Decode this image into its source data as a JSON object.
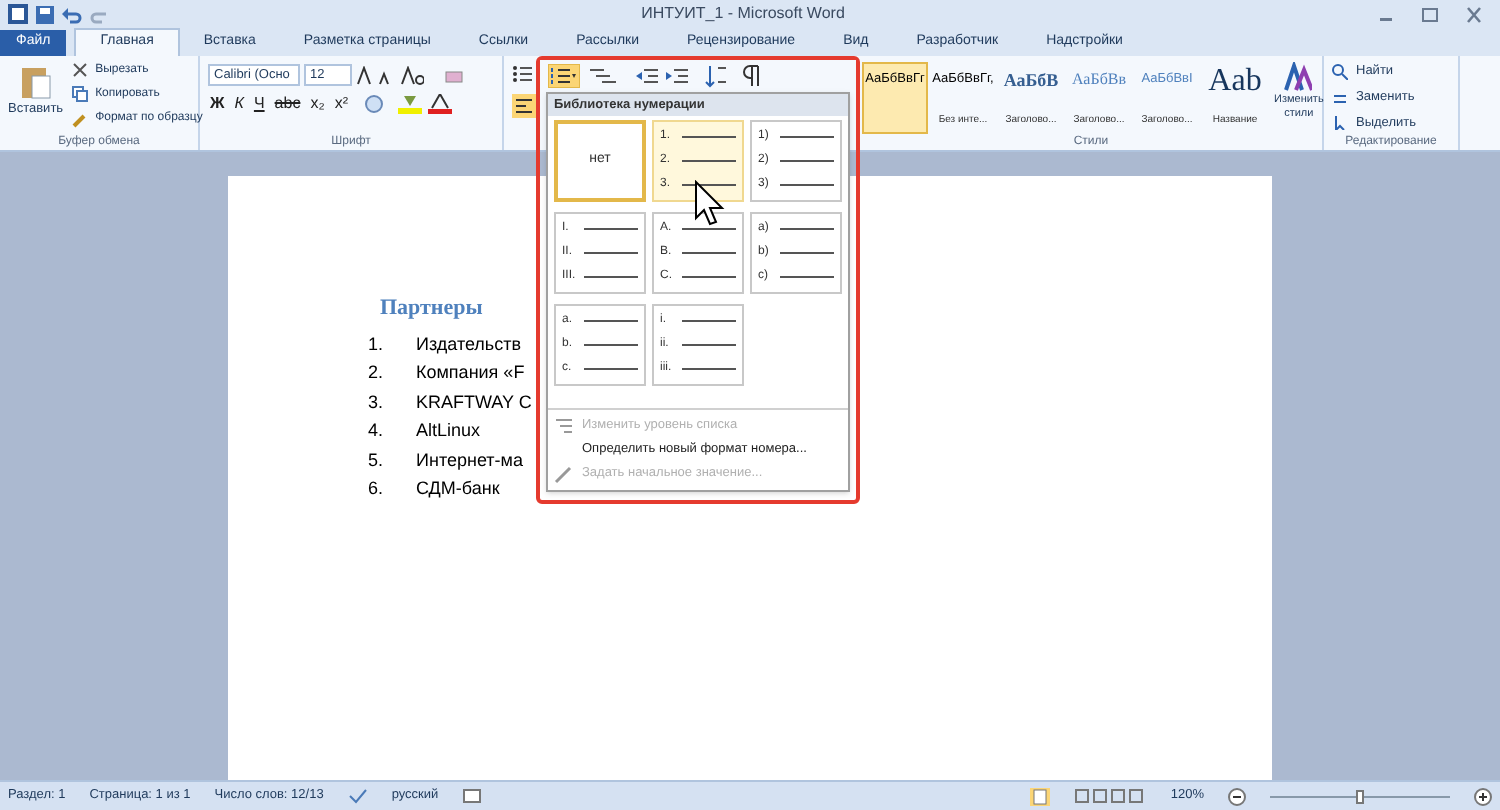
{
  "window": {
    "title": "ИНТУИТ_1 - Microsoft Word"
  },
  "tabs": [
    {
      "label": "Файл",
      "kind": "file",
      "selected": false
    },
    {
      "label": "Главная",
      "kind": "tab",
      "selected": true
    },
    {
      "label": "Вставка",
      "kind": "tab",
      "selected": false
    },
    {
      "label": "Разметка страницы",
      "kind": "tab",
      "selected": false
    },
    {
      "label": "Ссылки",
      "kind": "tab",
      "selected": false
    },
    {
      "label": "Рассылки",
      "kind": "tab",
      "selected": false
    },
    {
      "label": "Рецензирование",
      "kind": "tab",
      "selected": false
    },
    {
      "label": "Вид",
      "kind": "tab",
      "selected": false
    },
    {
      "label": "Разработчик",
      "kind": "tab",
      "selected": false
    },
    {
      "label": "Надстройки",
      "kind": "tab",
      "selected": false
    }
  ],
  "clipboard": {
    "paste": "Вставить",
    "commands": [
      "Вырезать",
      "Копировать",
      "Формат по образцу"
    ],
    "label": "Буфер обмена"
  },
  "font": {
    "font_name": "Calibri (Осно",
    "font_size": "12",
    "label": "Шрифт",
    "format_buttons": [
      "Ж",
      "К",
      "Ч",
      "abc",
      "x₂",
      "x²"
    ]
  },
  "styles": {
    "items": [
      {
        "sample": "АаБбВвГг",
        "selected": true
      },
      {
        "sample": "АаБбВвГг,",
        "name": "Без инте...",
        "selected": false
      },
      {
        "sample": "АаБбВ",
        "name": "Заголово...",
        "selected": false
      },
      {
        "sample": "АаБбВв",
        "name": "Заголово...",
        "selected": false
      },
      {
        "sample": "АаБбВвI",
        "name": "Заголово...",
        "selected": false
      },
      {
        "sample": "Aab",
        "name": "Название",
        "selected": false
      }
    ],
    "change_styles": "Изменить стили",
    "label": "Стили"
  },
  "editing": {
    "commands": [
      "Найти",
      "Заменить",
      "Выделить"
    ],
    "label": "Редактирование"
  },
  "numbering_dropdown": {
    "title": "Библиотека нумерации",
    "formats": [
      {
        "kind": "none",
        "label": "нет",
        "selected": true,
        "hovered": false
      },
      {
        "kind": "list",
        "markers": [
          "1.",
          "2.",
          "3."
        ],
        "selected": false,
        "hovered": true
      },
      {
        "kind": "list",
        "markers": [
          "1)",
          "2)",
          "3)"
        ],
        "selected": false,
        "hovered": false
      },
      {
        "kind": "list",
        "markers": [
          "I.",
          "II.",
          "III."
        ],
        "selected": false,
        "hovered": false
      },
      {
        "kind": "list",
        "markers": [
          "A.",
          "B.",
          "C."
        ],
        "selected": false,
        "hovered": false
      },
      {
        "kind": "list",
        "markers": [
          "a)",
          "b)",
          "c)"
        ],
        "selected": false,
        "hovered": false
      },
      {
        "kind": "list",
        "markers": [
          "a.",
          "b.",
          "c."
        ],
        "selected": false,
        "hovered": false
      },
      {
        "kind": "list",
        "markers": [
          "i.",
          "ii.",
          "iii."
        ],
        "selected": false,
        "hovered": false
      }
    ],
    "menu": [
      {
        "label": "Изменить уровень списка",
        "disabled": true
      },
      {
        "label": "Определить новый формат номера...",
        "disabled": false
      },
      {
        "label": "Задать начальное значение...",
        "disabled": true
      }
    ]
  },
  "document": {
    "heading": "Партнеры",
    "list": [
      {
        "number": "1.",
        "text": "Издательств"
      },
      {
        "number": "2.",
        "text": "Компания «F"
      },
      {
        "number": "3.",
        "text": "KRAFTWAY C"
      },
      {
        "number": "4.",
        "text": "AltLinux"
      },
      {
        "number": "5.",
        "text": "Интернет-ма"
      },
      {
        "number": "6.",
        "text": "СДМ-банк"
      }
    ]
  },
  "status_bar": {
    "items": [
      "Раздел: 1",
      "Страница: 1 из 1",
      "Число слов: 12/13",
      "русский"
    ],
    "zoom": "120%",
    "zoom_slider": {
      "level": 0.5
    }
  }
}
